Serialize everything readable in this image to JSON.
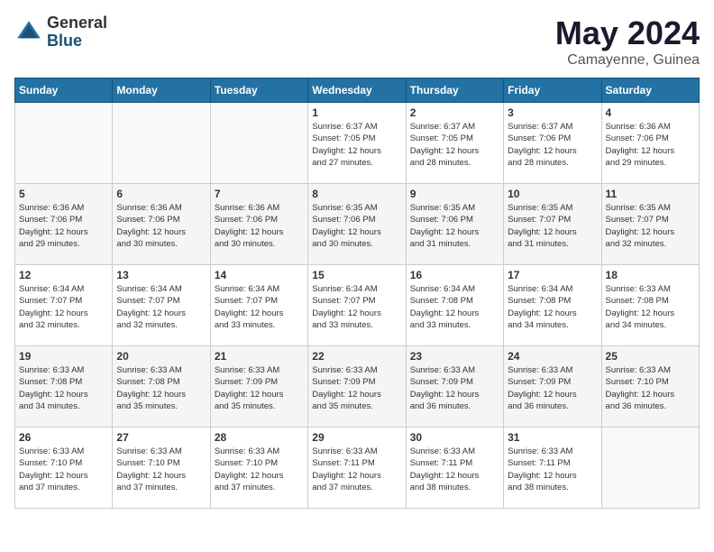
{
  "logo": {
    "general": "General",
    "blue": "Blue"
  },
  "title": {
    "month_year": "May 2024",
    "location": "Camayenne, Guinea"
  },
  "days_of_week": [
    "Sunday",
    "Monday",
    "Tuesday",
    "Wednesday",
    "Thursday",
    "Friday",
    "Saturday"
  ],
  "weeks": [
    [
      {
        "day": "",
        "info": ""
      },
      {
        "day": "",
        "info": ""
      },
      {
        "day": "",
        "info": ""
      },
      {
        "day": "1",
        "info": "Sunrise: 6:37 AM\nSunset: 7:05 PM\nDaylight: 12 hours\nand 27 minutes."
      },
      {
        "day": "2",
        "info": "Sunrise: 6:37 AM\nSunset: 7:05 PM\nDaylight: 12 hours\nand 28 minutes."
      },
      {
        "day": "3",
        "info": "Sunrise: 6:37 AM\nSunset: 7:06 PM\nDaylight: 12 hours\nand 28 minutes."
      },
      {
        "day": "4",
        "info": "Sunrise: 6:36 AM\nSunset: 7:06 PM\nDaylight: 12 hours\nand 29 minutes."
      }
    ],
    [
      {
        "day": "5",
        "info": "Sunrise: 6:36 AM\nSunset: 7:06 PM\nDaylight: 12 hours\nand 29 minutes."
      },
      {
        "day": "6",
        "info": "Sunrise: 6:36 AM\nSunset: 7:06 PM\nDaylight: 12 hours\nand 30 minutes."
      },
      {
        "day": "7",
        "info": "Sunrise: 6:36 AM\nSunset: 7:06 PM\nDaylight: 12 hours\nand 30 minutes."
      },
      {
        "day": "8",
        "info": "Sunrise: 6:35 AM\nSunset: 7:06 PM\nDaylight: 12 hours\nand 30 minutes."
      },
      {
        "day": "9",
        "info": "Sunrise: 6:35 AM\nSunset: 7:06 PM\nDaylight: 12 hours\nand 31 minutes."
      },
      {
        "day": "10",
        "info": "Sunrise: 6:35 AM\nSunset: 7:07 PM\nDaylight: 12 hours\nand 31 minutes."
      },
      {
        "day": "11",
        "info": "Sunrise: 6:35 AM\nSunset: 7:07 PM\nDaylight: 12 hours\nand 32 minutes."
      }
    ],
    [
      {
        "day": "12",
        "info": "Sunrise: 6:34 AM\nSunset: 7:07 PM\nDaylight: 12 hours\nand 32 minutes."
      },
      {
        "day": "13",
        "info": "Sunrise: 6:34 AM\nSunset: 7:07 PM\nDaylight: 12 hours\nand 32 minutes."
      },
      {
        "day": "14",
        "info": "Sunrise: 6:34 AM\nSunset: 7:07 PM\nDaylight: 12 hours\nand 33 minutes."
      },
      {
        "day": "15",
        "info": "Sunrise: 6:34 AM\nSunset: 7:07 PM\nDaylight: 12 hours\nand 33 minutes."
      },
      {
        "day": "16",
        "info": "Sunrise: 6:34 AM\nSunset: 7:08 PM\nDaylight: 12 hours\nand 33 minutes."
      },
      {
        "day": "17",
        "info": "Sunrise: 6:34 AM\nSunset: 7:08 PM\nDaylight: 12 hours\nand 34 minutes."
      },
      {
        "day": "18",
        "info": "Sunrise: 6:33 AM\nSunset: 7:08 PM\nDaylight: 12 hours\nand 34 minutes."
      }
    ],
    [
      {
        "day": "19",
        "info": "Sunrise: 6:33 AM\nSunset: 7:08 PM\nDaylight: 12 hours\nand 34 minutes."
      },
      {
        "day": "20",
        "info": "Sunrise: 6:33 AM\nSunset: 7:08 PM\nDaylight: 12 hours\nand 35 minutes."
      },
      {
        "day": "21",
        "info": "Sunrise: 6:33 AM\nSunset: 7:09 PM\nDaylight: 12 hours\nand 35 minutes."
      },
      {
        "day": "22",
        "info": "Sunrise: 6:33 AM\nSunset: 7:09 PM\nDaylight: 12 hours\nand 35 minutes."
      },
      {
        "day": "23",
        "info": "Sunrise: 6:33 AM\nSunset: 7:09 PM\nDaylight: 12 hours\nand 36 minutes."
      },
      {
        "day": "24",
        "info": "Sunrise: 6:33 AM\nSunset: 7:09 PM\nDaylight: 12 hours\nand 36 minutes."
      },
      {
        "day": "25",
        "info": "Sunrise: 6:33 AM\nSunset: 7:10 PM\nDaylight: 12 hours\nand 36 minutes."
      }
    ],
    [
      {
        "day": "26",
        "info": "Sunrise: 6:33 AM\nSunset: 7:10 PM\nDaylight: 12 hours\nand 37 minutes."
      },
      {
        "day": "27",
        "info": "Sunrise: 6:33 AM\nSunset: 7:10 PM\nDaylight: 12 hours\nand 37 minutes."
      },
      {
        "day": "28",
        "info": "Sunrise: 6:33 AM\nSunset: 7:10 PM\nDaylight: 12 hours\nand 37 minutes."
      },
      {
        "day": "29",
        "info": "Sunrise: 6:33 AM\nSunset: 7:11 PM\nDaylight: 12 hours\nand 37 minutes."
      },
      {
        "day": "30",
        "info": "Sunrise: 6:33 AM\nSunset: 7:11 PM\nDaylight: 12 hours\nand 38 minutes."
      },
      {
        "day": "31",
        "info": "Sunrise: 6:33 AM\nSunset: 7:11 PM\nDaylight: 12 hours\nand 38 minutes."
      },
      {
        "day": "",
        "info": ""
      }
    ]
  ]
}
